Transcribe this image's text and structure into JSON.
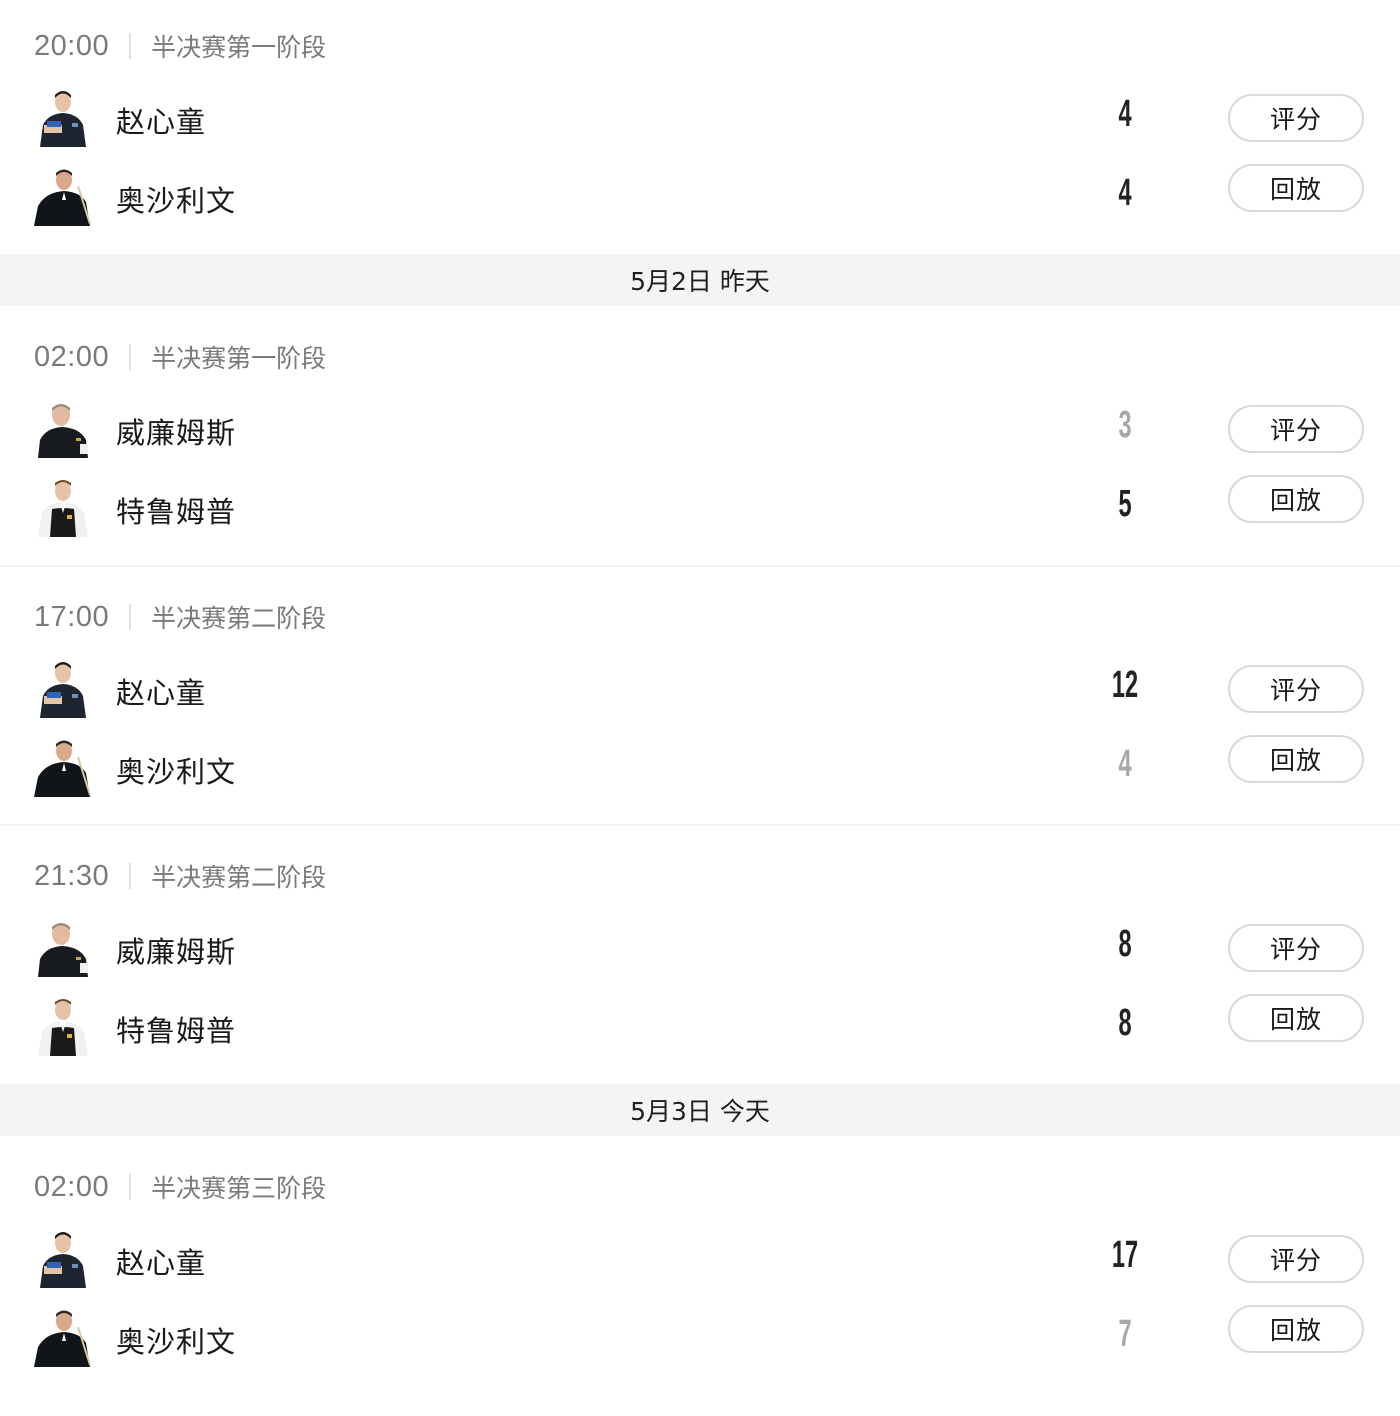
{
  "date_headers": [
    {
      "label": "5月2日 昨天"
    },
    {
      "label": "5月3日 今天"
    }
  ],
  "matches": [
    {
      "time": "20:00",
      "stage": "半决赛第一阶段",
      "players": [
        {
          "name": "赵心童",
          "score": "4",
          "avatar": "zhao",
          "winner": true
        },
        {
          "name": "奥沙利文",
          "score": "4",
          "avatar": "osullivan",
          "winner": true
        }
      ],
      "buttons": {
        "rate": "评分",
        "replay": "回放"
      }
    },
    {
      "time": "02:00",
      "stage": "半决赛第一阶段",
      "players": [
        {
          "name": "威廉姆斯",
          "score": "3",
          "avatar": "williams",
          "winner": false
        },
        {
          "name": "特鲁姆普",
          "score": "5",
          "avatar": "trump",
          "winner": true
        }
      ],
      "buttons": {
        "rate": "评分",
        "replay": "回放"
      }
    },
    {
      "time": "17:00",
      "stage": "半决赛第二阶段",
      "players": [
        {
          "name": "赵心童",
          "score": "12",
          "avatar": "zhao",
          "winner": true
        },
        {
          "name": "奥沙利文",
          "score": "4",
          "avatar": "osullivan",
          "winner": false
        }
      ],
      "buttons": {
        "rate": "评分",
        "replay": "回放"
      }
    },
    {
      "time": "21:30",
      "stage": "半决赛第二阶段",
      "players": [
        {
          "name": "威廉姆斯",
          "score": "8",
          "avatar": "williams",
          "winner": true
        },
        {
          "name": "特鲁姆普",
          "score": "8",
          "avatar": "trump",
          "winner": true
        }
      ],
      "buttons": {
        "rate": "评分",
        "replay": "回放"
      }
    },
    {
      "time": "02:00",
      "stage": "半决赛第三阶段",
      "players": [
        {
          "name": "赵心童",
          "score": "17",
          "avatar": "zhao",
          "winner": true
        },
        {
          "name": "奥沙利文",
          "score": "7",
          "avatar": "osullivan",
          "winner": false
        }
      ],
      "buttons": {
        "rate": "评分",
        "replay": "回放"
      }
    }
  ],
  "colors": {
    "winner_score": "#222222",
    "loser_score": "#a8a8a8",
    "date_bar": "#f4f4f6"
  }
}
